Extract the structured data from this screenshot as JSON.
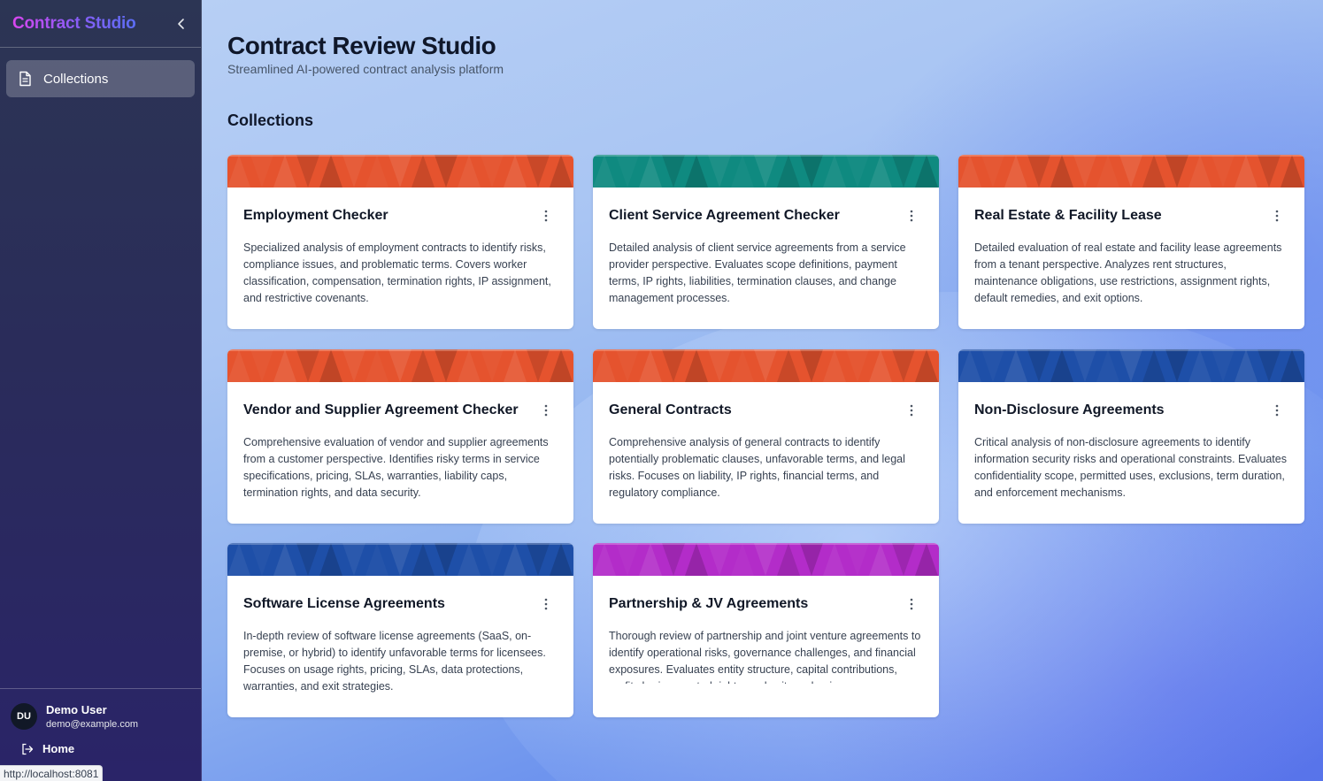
{
  "sidebar": {
    "brand": "Contract Studio",
    "nav": [
      {
        "label": "Collections",
        "icon": "document-icon"
      }
    ],
    "user": {
      "initials": "DU",
      "name": "Demo User",
      "email": "demo@example.com"
    },
    "home_label": "Home"
  },
  "status_url": "http://localhost:8081",
  "header": {
    "title": "Contract Review Studio",
    "subtitle": "Streamlined AI-powered contract analysis platform"
  },
  "section_title": "Collections",
  "colors": {
    "orange": "#e5532e",
    "teal": "#0f8a80",
    "blue": "#1e4fa8",
    "purple": "#b32cc9"
  },
  "collections": [
    {
      "title": "Employment Checker",
      "theme": "orange",
      "description": "Specialized analysis of employment contracts to identify risks, compliance issues, and problematic terms. Covers worker classification, compensation, termination rights, IP assignment, and restrictive covenants."
    },
    {
      "title": "Client Service Agreement Checker",
      "theme": "teal",
      "description": "Detailed analysis of client service agreements from a service provider perspective. Evaluates scope definitions, payment terms, IP rights, liabilities, termination clauses, and change management processes."
    },
    {
      "title": "Real Estate & Facility Lease",
      "theme": "orange",
      "description": "Detailed evaluation of real estate and facility lease agreements from a tenant perspective. Analyzes rent structures, maintenance obligations, use restrictions, assignment rights, default remedies, and exit options."
    },
    {
      "title": "Vendor and Supplier Agreement Checker",
      "theme": "orange",
      "description": "Comprehensive evaluation of vendor and supplier agreements from a customer perspective. Identifies risky terms in service specifications, pricing, SLAs, warranties, liability caps, termination rights, and data security."
    },
    {
      "title": "General Contracts",
      "theme": "orange",
      "description": "Comprehensive analysis of general contracts to identify potentially problematic clauses, unfavorable terms, and legal risks. Focuses on liability, IP rights, financial terms, and regulatory compliance."
    },
    {
      "title": "Non-Disclosure Agreements",
      "theme": "blue",
      "description": "Critical analysis of non-disclosure agreements to identify information security risks and operational constraints. Evaluates confidentiality scope, permitted uses, exclusions, term duration, and enforcement mechanisms."
    },
    {
      "title": "Software License Agreements",
      "theme": "blue",
      "description": "In-depth review of software license agreements (SaaS, on-premise, or hybrid) to identify unfavorable terms for licensees. Focuses on usage rights, pricing, SLAs, data protections, warranties, and exit strategies."
    },
    {
      "title": "Partnership & JV Agreements",
      "theme": "purple",
      "description": "Thorough review of partnership and joint venture agreements to identify operational risks, governance challenges, and financial exposures. Evaluates entity structure, capital contributions, profit sharing, control rights, and exit mechanisms."
    }
  ]
}
